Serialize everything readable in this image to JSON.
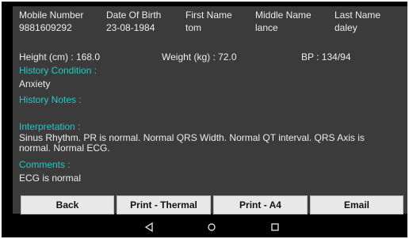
{
  "patient": {
    "headers": [
      "Mobile Number",
      "Date Of Birth",
      "First Name",
      "Middle Name",
      "Last Name"
    ],
    "values": [
      "9881609292",
      "23-08-1984",
      "tom",
      "lance",
      "daley"
    ]
  },
  "vitals": {
    "height": "Height (cm) : 168.0",
    "weight": "Weight (kg) : 72.0",
    "bp": "BP : 134/94"
  },
  "history_condition": {
    "label": "History Condition :",
    "value": "Anxiety"
  },
  "history_notes": {
    "label": "History Notes :",
    "value": ""
  },
  "interpretation": {
    "label": "Interpretation :",
    "value": "Sinus Rhythm. PR is normal. Normal QRS Width. Normal QT interval. QRS Axis is normal. Normal ECG."
  },
  "comments": {
    "label": "Comments :",
    "value": "ECG is normal"
  },
  "buttons": {
    "back": "Back",
    "print_thermal": "Print - Thermal",
    "print_a4": "Print - A4",
    "email": "Email"
  },
  "nav": {
    "back_icon": "triangle-back-icon",
    "home_icon": "circle-home-icon",
    "recents_icon": "square-recents-icon"
  },
  "colors": {
    "accent": "#27c8c8",
    "panel": "#3b3b3b",
    "button": "#e8e8e8"
  }
}
